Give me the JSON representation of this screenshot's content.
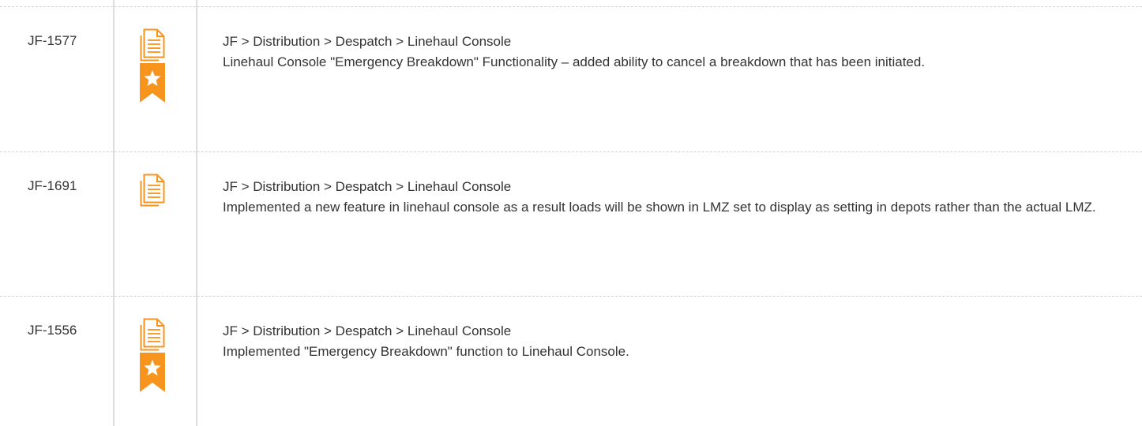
{
  "rows": [
    {
      "id": "JF-1577",
      "path": "JF > Distribution > Despatch > Linehaul Console",
      "description": "Linehaul Console \"Emergency Breakdown\" Functionality – added ability to cancel a breakdown that has been initiated.",
      "icons": [
        "document-icon",
        "star-ribbon-icon"
      ]
    },
    {
      "id": "JF-1691",
      "path": "JF > Distribution > Despatch > Linehaul Console",
      "description": "Implemented a new feature in linehaul console as a result loads will be shown in LMZ set to display as setting in depots rather than the actual LMZ.",
      "icons": [
        "document-icon"
      ]
    },
    {
      "id": "JF-1556",
      "path": "JF > Distribution > Despatch > Linehaul Console",
      "description": "Implemented \"Emergency Breakdown\" function to Linehaul Console.",
      "icons": [
        "document-icon",
        "star-ribbon-icon"
      ]
    }
  ],
  "colors": {
    "icon_orange": "#f7941d",
    "text": "#333333",
    "border": "#dddddd"
  }
}
